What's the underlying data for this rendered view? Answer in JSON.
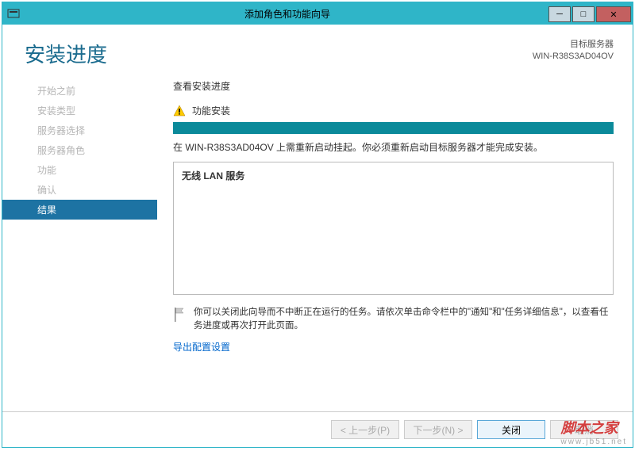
{
  "window": {
    "title": "添加角色和功能向导"
  },
  "header": {
    "page_title": "安装进度",
    "target_label": "目标服务器",
    "target_name": "WIN-R38S3AD04OV"
  },
  "sidebar": {
    "items": [
      {
        "label": "开始之前"
      },
      {
        "label": "安装类型"
      },
      {
        "label": "服务器选择"
      },
      {
        "label": "服务器角色"
      },
      {
        "label": "功能"
      },
      {
        "label": "确认"
      },
      {
        "label": "结果"
      }
    ],
    "active_index": 6
  },
  "main": {
    "section_label": "查看安装进度",
    "install_label": "功能安装",
    "status_text": "在 WIN-R38S3AD04OV 上需重新启动挂起。你必须重新启动目标服务器才能完成安装。",
    "feature_name": "无线 LAN 服务",
    "info_text": "你可以关闭此向导而不中断正在运行的任务。请依次单击命令栏中的\"通知\"和\"任务详细信息\"，以查看任务进度或再次打开此页面。",
    "export_link": "导出配置设置"
  },
  "footer": {
    "prev": "< 上一步(P)",
    "next": "下一步(N) >",
    "close": "关闭",
    "cancel": "取消"
  },
  "watermark": {
    "text": "脚本之家",
    "url": "www.jb51.net"
  }
}
